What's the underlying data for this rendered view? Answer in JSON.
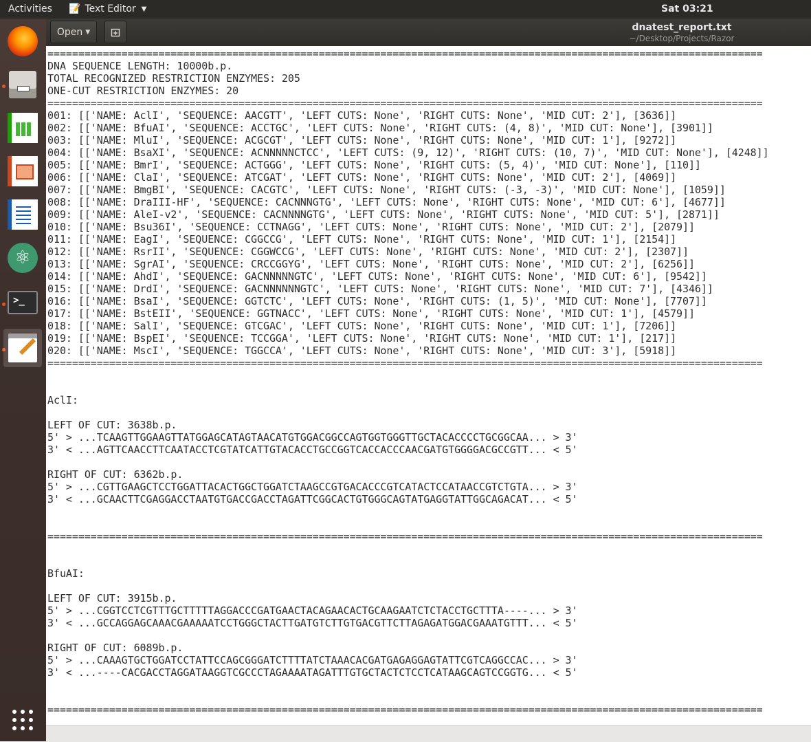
{
  "topbar": {
    "activities": "Activities",
    "app_name": "Text Editor",
    "clock": "Sat 03:21"
  },
  "headerbar": {
    "open_label": "Open",
    "filename": "dnatest_report.txt",
    "path": "~/Desktop/Projects/Razor"
  },
  "launcher": [
    "firefox-icon",
    "files-icon",
    "libreoffice-calc-icon",
    "libreoffice-impress-icon",
    "libreoffice-writer-icon",
    "atom-icon",
    "terminal-icon",
    "text-editor-icon"
  ],
  "document": {
    "lines": [
      "====================================================================================================================",
      "DNA SEQUENCE LENGTH: 10000b.p.",
      "TOTAL RECOGNIZED RESTRICTION ENZYMES: 205",
      "ONE-CUT RESTRICTION ENZYMES: 20",
      "====================================================================================================================",
      "001: [['NAME: AclI', 'SEQUENCE: AACGTT', 'LEFT CUTS: None', 'RIGHT CUTS: None', 'MID CUT: 2'], [3636]]",
      "002: [['NAME: BfuAI', 'SEQUENCE: ACCTGC', 'LEFT CUTS: None', 'RIGHT CUTS: (4, 8)', 'MID CUT: None'], [3901]]",
      "003: [['NAME: MluI', 'SEQUENCE: ACGCGT', 'LEFT CUTS: None', 'RIGHT CUTS: None', 'MID CUT: 1'], [9272]]",
      "004: [['NAME: BsaXI', 'SEQUENCE: ACNNNNNCTCC', 'LEFT CUTS: (9, 12)', 'RIGHT CUTS: (10, 7)', 'MID CUT: None'], [4248]]",
      "005: [['NAME: BmrI', 'SEQUENCE: ACTGGG', 'LEFT CUTS: None', 'RIGHT CUTS: (5, 4)', 'MID CUT: None'], [110]]",
      "006: [['NAME: ClaI', 'SEQUENCE: ATCGAT', 'LEFT CUTS: None', 'RIGHT CUTS: None', 'MID CUT: 2'], [4069]]",
      "007: [['NAME: BmgBI', 'SEQUENCE: CACGTC', 'LEFT CUTS: None', 'RIGHT CUTS: (-3, -3)', 'MID CUT: None'], [1059]]",
      "008: [['NAME: DraIII-HF', 'SEQUENCE: CACNNNGTG', 'LEFT CUTS: None', 'RIGHT CUTS: None', 'MID CUT: 6'], [4677]]",
      "009: [['NAME: AleI-v2', 'SEQUENCE: CACNNNNGTG', 'LEFT CUTS: None', 'RIGHT CUTS: None', 'MID CUT: 5'], [2871]]",
      "010: [['NAME: Bsu36I', 'SEQUENCE: CCTNAGG', 'LEFT CUTS: None', 'RIGHT CUTS: None', 'MID CUT: 2'], [2079]]",
      "011: [['NAME: EagI', 'SEQUENCE: CGGCCG', 'LEFT CUTS: None', 'RIGHT CUTS: None', 'MID CUT: 1'], [2154]]",
      "012: [['NAME: RsrII', 'SEQUENCE: CGGWCCG', 'LEFT CUTS: None', 'RIGHT CUTS: None', 'MID CUT: 2'], [2307]]",
      "013: [['NAME: SgrAI', 'SEQUENCE: CRCCGGYG', 'LEFT CUTS: None', 'RIGHT CUTS: None', 'MID CUT: 2'], [6256]]",
      "014: [['NAME: AhdI', 'SEQUENCE: GACNNNNNGTC', 'LEFT CUTS: None', 'RIGHT CUTS: None', 'MID CUT: 6'], [9542]]",
      "015: [['NAME: DrdI', 'SEQUENCE: GACNNNNNNGTC', 'LEFT CUTS: None', 'RIGHT CUTS: None', 'MID CUT: 7'], [4346]]",
      "016: [['NAME: BsaI', 'SEQUENCE: GGTCTC', 'LEFT CUTS: None', 'RIGHT CUTS: (1, 5)', 'MID CUT: None'], [7707]]",
      "017: [['NAME: BstEII', 'SEQUENCE: GGTNACC', 'LEFT CUTS: None', 'RIGHT CUTS: None', 'MID CUT: 1'], [4579]]",
      "018: [['NAME: SalI', 'SEQUENCE: GTCGAC', 'LEFT CUTS: None', 'RIGHT CUTS: None', 'MID CUT: 1'], [7206]]",
      "019: [['NAME: BspEI', 'SEQUENCE: TCCGGA', 'LEFT CUTS: None', 'RIGHT CUTS: None', 'MID CUT: 1'], [217]]",
      "020: [['NAME: MscI', 'SEQUENCE: TGGCCA', 'LEFT CUTS: None', 'RIGHT CUTS: None', 'MID CUT: 3'], [5918]]",
      "====================================================================================================================",
      "",
      "",
      "AclI:",
      "",
      "LEFT OF CUT: 3638b.p.",
      "5' > ...TCAAGTTGGAAGTTATGGAGCATAGTAACATGTGGACGGCCAGTGGTGGGTTGCTACACCCCTGCGGCAA... > 3'",
      "3' < ...AGTTCAACCTTCAATACCTCGTATCATTGTACACCTGCCGGTCACCACCCAACGATGTGGGGACGCCGTT... < 5'",
      "",
      "RIGHT OF CUT: 6362b.p.",
      "5' > ...CGTTGAAGCTCCTGGATTACACTGGCTGGATCTAAGCCGTGACACCCGTCATACTCCATAACCGTCTGTA... > 3'",
      "3' < ...GCAACTTCGAGGACCTAATGTGACCGACCTAGATTCGGCACTGTGGGCAGTATGAGGTATTGGCAGACAT... < 5'",
      "",
      "",
      "====================================================================================================================",
      "",
      "",
      "BfuAI:",
      "",
      "LEFT OF CUT: 3915b.p.",
      "5' > ...CGGTCCTCGTTTGCTTTTTAGGACCCGATGAACTACAGAACACTGCAAGAATCTCTACCTGCTTTA----... > 3'",
      "3' < ...GCCAGGAGCAAACGAAAAATCCTGGGCTACTTGATGTCTTGTGACGTTCTTAGAGATGGACGAAATGTTT... < 5'",
      "",
      "RIGHT OF CUT: 6089b.p.",
      "5' > ...CAAAGTGCTGGATCCTATTCCAGCGGGATCTTTTATCTAAACACGATGAGAGGAGTATTCGTCAGGCCAC... > 3'",
      "3' < ...----CACGACCTAGGATAAGGTCGCCCTAGAAAATAGATTTGTGCTACTCTCCTCATAAGCAGTCCGGTG... < 5'",
      "",
      "",
      "===================================================================================================================="
    ]
  }
}
